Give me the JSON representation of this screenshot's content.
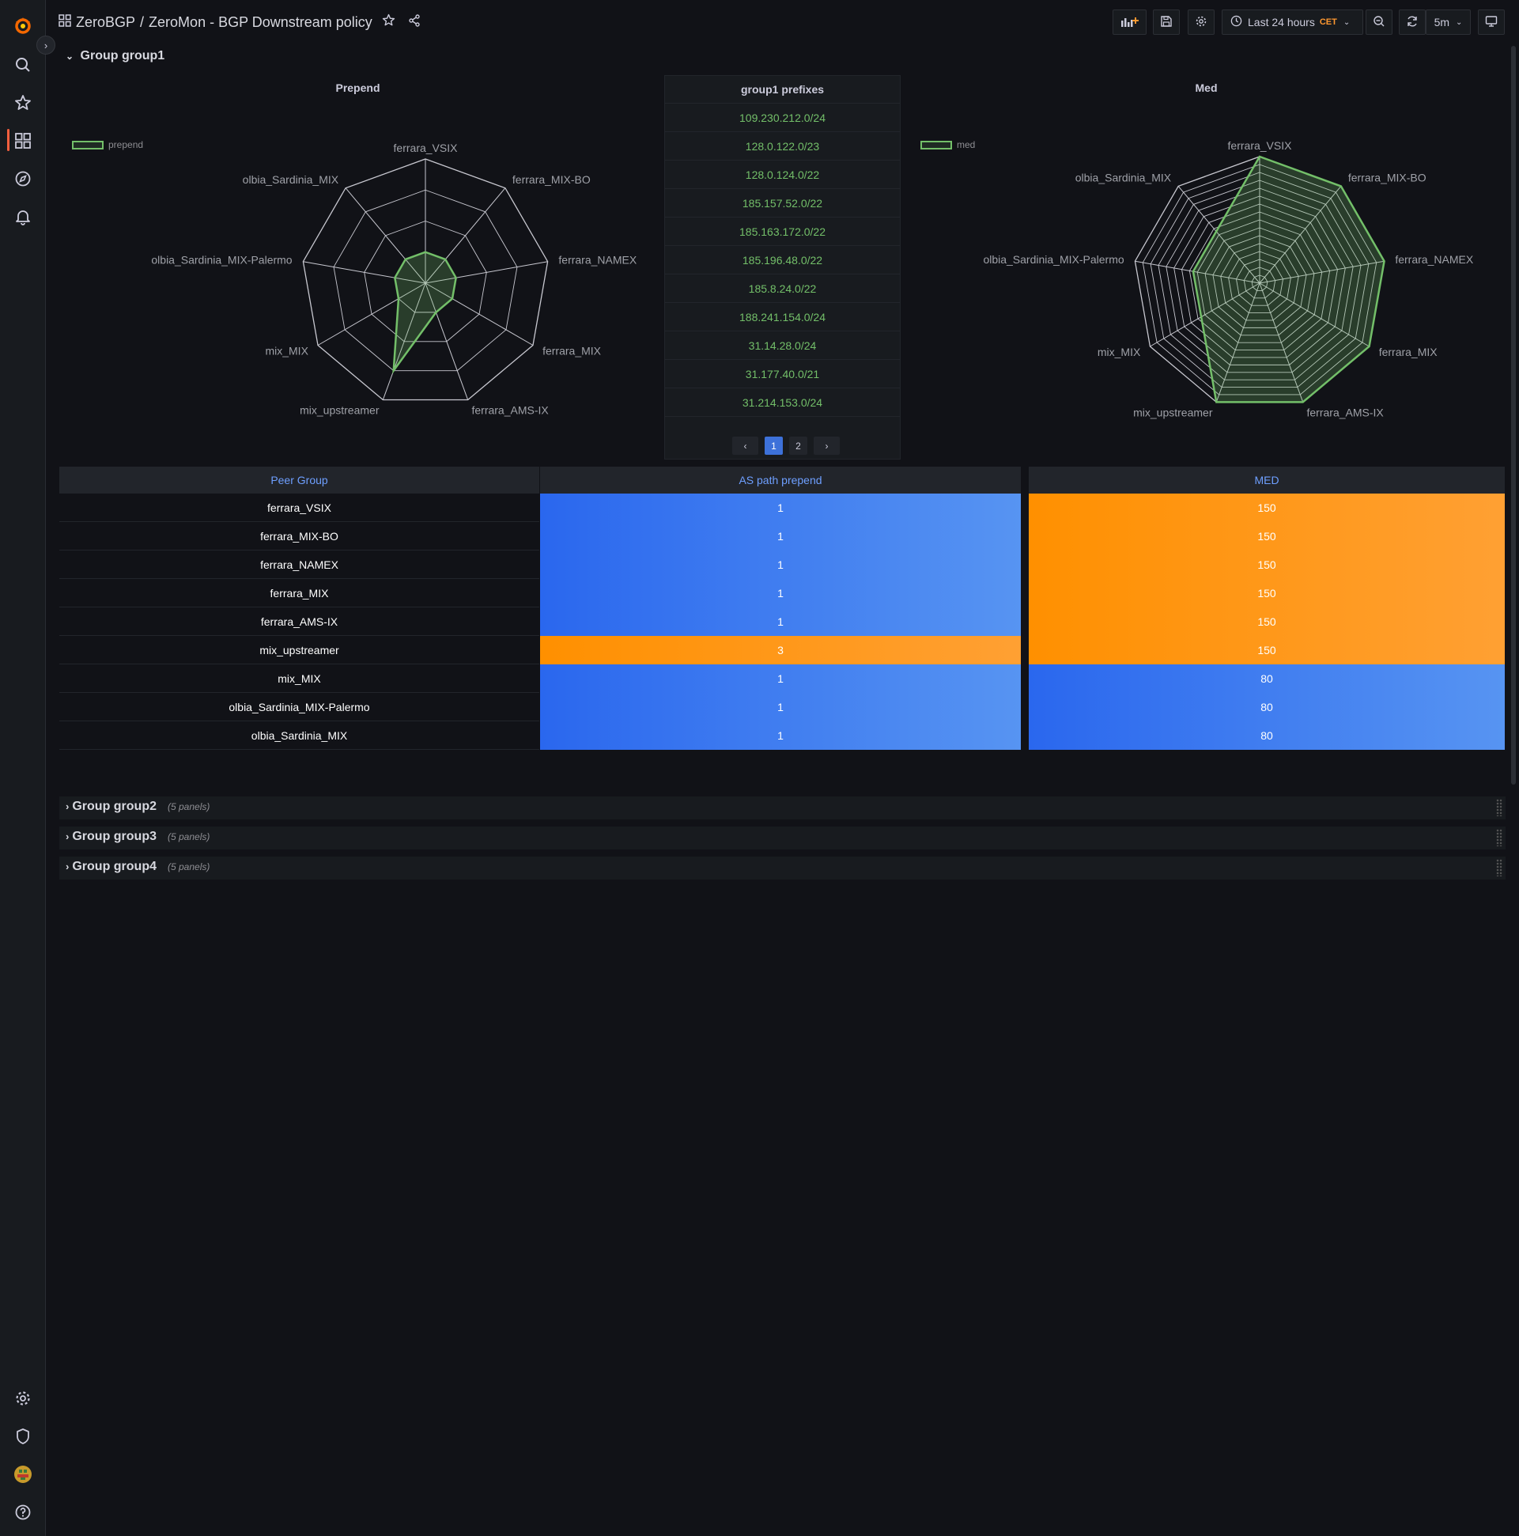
{
  "breadcrumb": {
    "folder": "ZeroBGP",
    "separator": "/",
    "dashboard": "ZeroMon - BGP Downstream policy"
  },
  "toolbar": {
    "time_range": "Last 24 hours",
    "timezone": "CET",
    "refresh_interval": "5m"
  },
  "rows": {
    "group1": {
      "title": "Group group1"
    },
    "collapsed": [
      {
        "title": "Group group2",
        "count": "(5 panels)"
      },
      {
        "title": "Group group3",
        "count": "(5 panels)"
      },
      {
        "title": "Group group4",
        "count": "(5 panels)"
      }
    ]
  },
  "prepend_panel": {
    "title": "Prepend",
    "legend": "prepend"
  },
  "med_panel": {
    "title": "Med",
    "legend": "med"
  },
  "prefixes_panel": {
    "title": "group1 prefixes",
    "prefixes": [
      "109.230.212.0/24",
      "128.0.122.0/23",
      "128.0.124.0/22",
      "185.157.52.0/22",
      "185.163.172.0/22",
      "185.196.48.0/22",
      "185.8.24.0/22",
      "188.241.154.0/24",
      "31.14.28.0/24",
      "31.177.40.0/21",
      "31.214.153.0/24"
    ],
    "pages": [
      "1",
      "2"
    ],
    "prev_icon": "‹",
    "next_icon": "›"
  },
  "peer_table": {
    "headers": [
      "Peer Group",
      "AS path prepend",
      "MED"
    ],
    "rows": [
      {
        "peer": "ferrara_VSIX",
        "prepend": "1",
        "med": "150",
        "prepend_color": "blue",
        "med_color": "orange"
      },
      {
        "peer": "ferrara_MIX-BO",
        "prepend": "1",
        "med": "150",
        "prepend_color": "blue",
        "med_color": "orange"
      },
      {
        "peer": "ferrara_NAMEX",
        "prepend": "1",
        "med": "150",
        "prepend_color": "blue",
        "med_color": "orange"
      },
      {
        "peer": "ferrara_MIX",
        "prepend": "1",
        "med": "150",
        "prepend_color": "blue",
        "med_color": "orange"
      },
      {
        "peer": "ferrara_AMS-IX",
        "prepend": "1",
        "med": "150",
        "prepend_color": "blue",
        "med_color": "orange"
      },
      {
        "peer": "mix_upstreamer",
        "prepend": "3",
        "med": "150",
        "prepend_color": "orange",
        "med_color": "orange"
      },
      {
        "peer": "mix_MIX",
        "prepend": "1",
        "med": "80",
        "prepend_color": "blue",
        "med_color": "blue"
      },
      {
        "peer": "olbia_Sardinia_MIX-Palermo",
        "prepend": "1",
        "med": "80",
        "prepend_color": "blue",
        "med_color": "blue"
      },
      {
        "peer": "olbia_Sardinia_MIX",
        "prepend": "1",
        "med": "80",
        "prepend_color": "blue",
        "med_color": "blue"
      }
    ]
  },
  "chart_data": [
    {
      "type": "radar",
      "title": "Prepend",
      "axes": [
        "ferrara_VSIX",
        "ferrara_MIX-BO",
        "ferrara_NAMEX",
        "ferrara_MIX",
        "ferrara_AMS-IX",
        "mix_upstreamer",
        "mix_MIX",
        "olbia_Sardinia_MIX-Palermo",
        "olbia_Sardinia_MIX"
      ],
      "series": [
        {
          "name": "prepend",
          "values": [
            1,
            1,
            1,
            1,
            1,
            3,
            1,
            1,
            1
          ]
        }
      ],
      "rmax": 4,
      "color": "#73bf69"
    },
    {
      "type": "radar",
      "title": "Med",
      "axes": [
        "ferrara_VSIX",
        "ferrara_MIX-BO",
        "ferrara_NAMEX",
        "ferrara_MIX",
        "ferrara_AMS-IX",
        "mix_upstreamer",
        "mix_MIX",
        "olbia_Sardinia_MIX-Palermo",
        "olbia_Sardinia_MIX"
      ],
      "series": [
        {
          "name": "med",
          "values": [
            150,
            150,
            150,
            150,
            150,
            150,
            80,
            80,
            80
          ]
        }
      ],
      "rmax": 150,
      "color": "#73bf69"
    }
  ],
  "colors": {
    "blue": "#3d71d9",
    "orange": "#ff9830",
    "green": "#73bf69",
    "accent": "#f55f3e"
  }
}
